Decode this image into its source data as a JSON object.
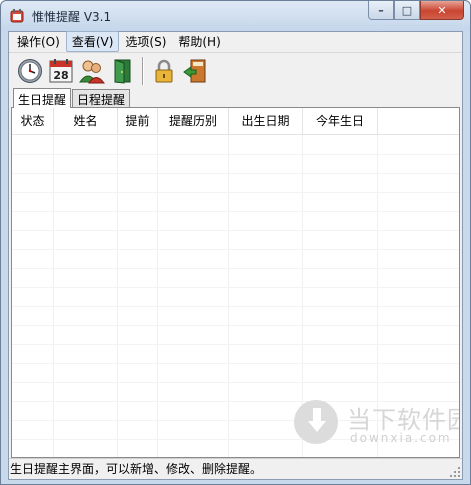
{
  "window": {
    "title": "惟惟提醒 V3.1",
    "buttons": {
      "minimize": "–",
      "maximize": "□",
      "close": "✕"
    }
  },
  "menu": [
    {
      "label": "操作(O)"
    },
    {
      "label": "查看(V)"
    },
    {
      "label": "选项(S)"
    },
    {
      "label": "帮助(H)"
    }
  ],
  "toolbar": {
    "calendar_day": "28",
    "icons": [
      "clock-icon",
      "calendar-icon",
      "contacts-icon",
      "exit-door-icon",
      "lock-icon",
      "exit-icon"
    ]
  },
  "tabs": [
    {
      "label": "生日提醒",
      "active": true
    },
    {
      "label": "日程提醒",
      "active": false
    }
  ],
  "table": {
    "columns": [
      "状态",
      "姓名",
      "提前",
      "提醒历别",
      "出生日期",
      "今年生日"
    ],
    "rows": []
  },
  "watermark": {
    "text": "当下软件园",
    "url": "downxia.com"
  },
  "status": {
    "text": "生日提醒主界面，可以新增、修改、删除提醒。"
  },
  "colors": {
    "titlebar": "#c4d6eb",
    "close_button": "#c94531",
    "window_bg": "#f0f0f0"
  }
}
